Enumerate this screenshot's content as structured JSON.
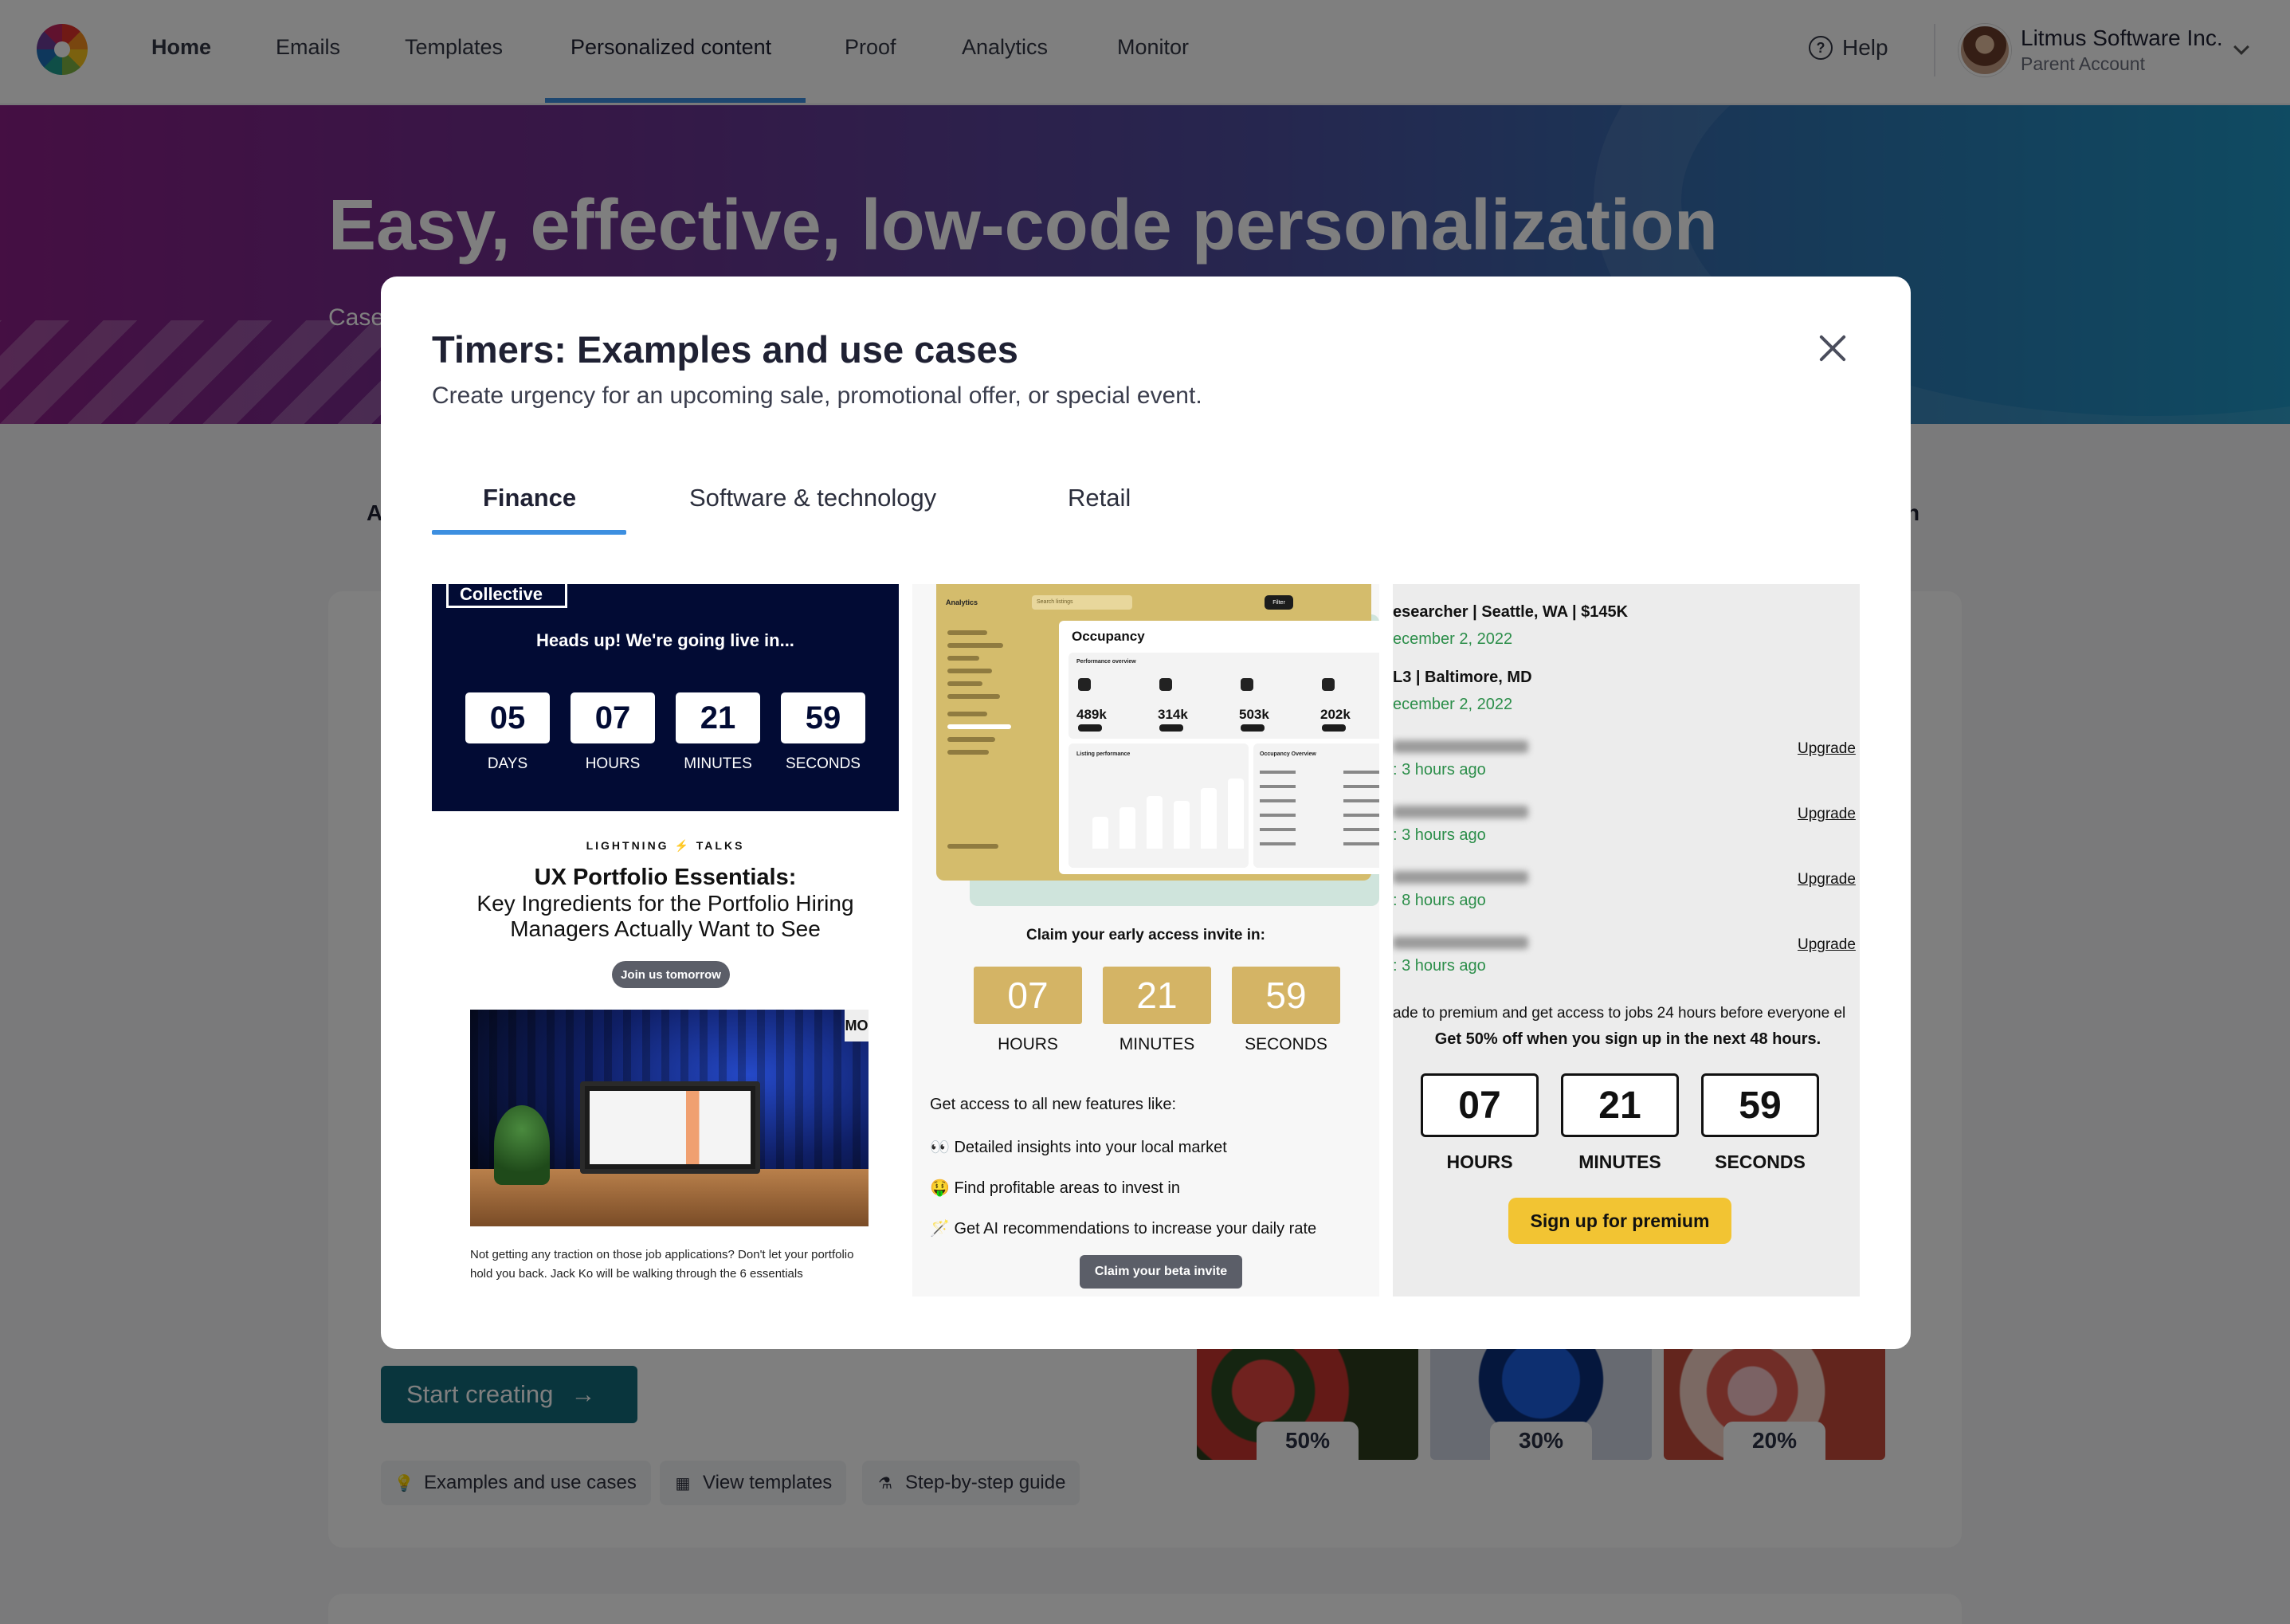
{
  "nav": {
    "items": [
      "Home",
      "Emails",
      "Templates",
      "Personalized content",
      "Proof",
      "Analytics",
      "Monitor"
    ],
    "active": "Personalized content",
    "help": "Help",
    "account_name": "Litmus Software Inc.",
    "account_sub": "Parent Account"
  },
  "hero": {
    "title": "Easy, effective, low-code personalization",
    "subtitle": "Case"
  },
  "page": {
    "category_left": "A",
    "category_right": "n",
    "start_button": "Start creating",
    "links": [
      "Examples and use cases",
      "View templates",
      "Step-by-step guide"
    ],
    "discounts": [
      "50%",
      "30%",
      "20%"
    ]
  },
  "modal": {
    "title": "Timers: Examples and use cases",
    "subtitle": "Create urgency for an upcoming sale, promotional offer, or special event.",
    "tabs": [
      "Finance",
      "Software & technology",
      "Retail"
    ],
    "active_tab": "Finance"
  },
  "example1": {
    "brand": "Collective",
    "headline": "Heads up! We're going live in...",
    "countdown": [
      {
        "value": "05",
        "label": "DAYS"
      },
      {
        "value": "07",
        "label": "HOURS"
      },
      {
        "value": "21",
        "label": "MINUTES"
      },
      {
        "value": "59",
        "label": "SECONDS"
      }
    ],
    "kicker": "LIGHTNING ⚡ TALKS",
    "title": "UX Portfolio Essentials:",
    "subtitle": "Key Ingredients for the Portfolio Hiring Managers Actually Want to See",
    "button": "Join us tomorrow",
    "photo_tag": "MO",
    "body": "Not getting any traction on those job applications? Don't let your portfolio hold you back. Jack Ko will be walking through the 6 essentials"
  },
  "example2": {
    "dashboard": {
      "app": "Analytics",
      "search": "Search listings",
      "filter": "Filter",
      "title": "Occupancy",
      "panel_title": "Performance overview",
      "metrics": [
        "489k",
        "314k",
        "503k",
        "202k"
      ],
      "chart_title": "Listing performance",
      "overview_title": "Occupancy Overview"
    },
    "claim": "Claim your early access invite in:",
    "countdown": [
      {
        "value": "07",
        "label": "HOURS"
      },
      {
        "value": "21",
        "label": "MINUTES"
      },
      {
        "value": "59",
        "label": "SECONDS"
      }
    ],
    "access": "Get access to all new features like:",
    "features": [
      "👀 Detailed insights into your local market",
      "🤑 Find profitable areas to invest in",
      "🪄 Get AI recommendations to increase your daily rate"
    ],
    "button": "Claim your beta invite"
  },
  "example3": {
    "jobs": [
      {
        "title": "esearcher | Seattle, WA | $145K",
        "date": "ecember 2, 2022"
      },
      {
        "title": "L3 | Baltimore, MD",
        "date": "ecember 2, 2022"
      }
    ],
    "locked": [
      {
        "ago": ": 3 hours ago",
        "action": "Upgrade"
      },
      {
        "ago": ": 3 hours ago",
        "action": "Upgrade"
      },
      {
        "ago": ": 8 hours ago",
        "action": "Upgrade"
      },
      {
        "ago": ": 3 hours ago",
        "action": "Upgrade"
      }
    ],
    "upsell": "ade to premium and get access to jobs 24 hours before everyone el",
    "offer": "Get 50% off when you sign up in the next 48 hours.",
    "countdown": [
      {
        "value": "07",
        "label": "HOURS"
      },
      {
        "value": "21",
        "label": "MINUTES"
      },
      {
        "value": "59",
        "label": "SECONDS"
      }
    ],
    "button": "Sign up for premium"
  },
  "colors": {
    "accent": "#3d8fe0",
    "start_button": "#136a7b",
    "finance_navy": "#020b34",
    "gold": "#d4b465",
    "premium_yellow": "#f2c433"
  }
}
